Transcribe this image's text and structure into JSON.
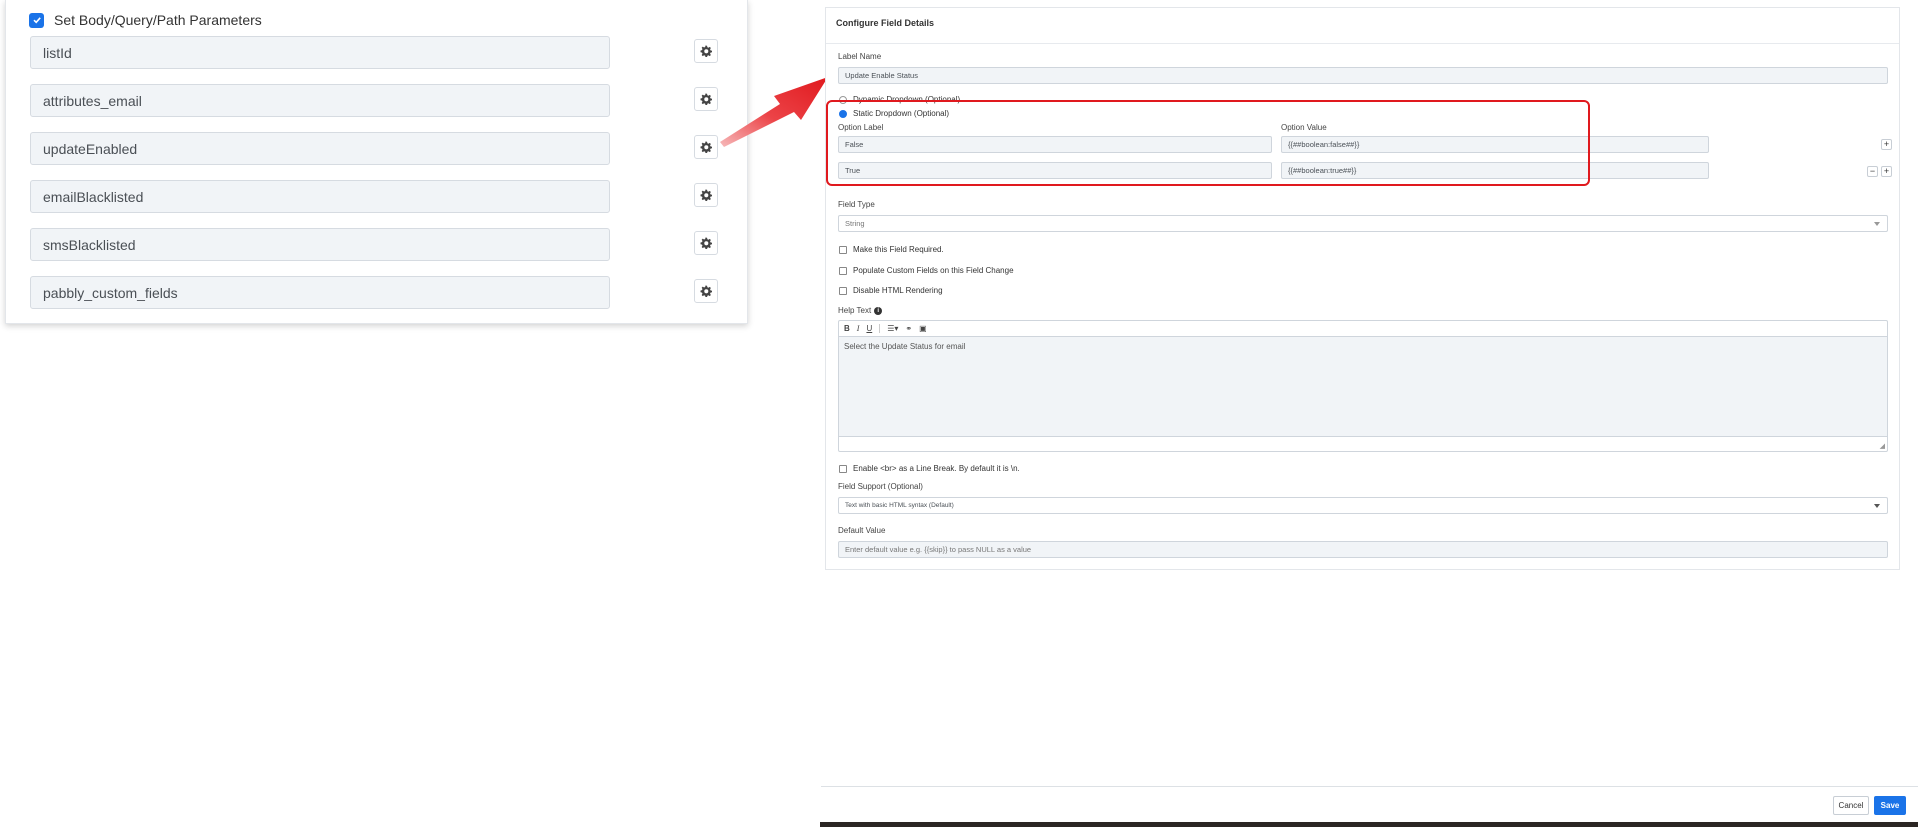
{
  "params": {
    "title": "Set Body/Query/Path Parameters",
    "items": [
      {
        "label": "listId"
      },
      {
        "label": "attributes_email"
      },
      {
        "label": "updateEnabled"
      },
      {
        "label": "emailBlacklisted"
      },
      {
        "label": "smsBlacklisted"
      },
      {
        "label": "pabbly_custom_fields"
      }
    ]
  },
  "config": {
    "title": "Configure Field Details",
    "label_name_label": "Label Name",
    "label_name_value": "Update Enable Status",
    "dynamic_dropdown_label": "Dynamic Dropdown (Optional)",
    "static_dropdown_label": "Static Dropdown (Optional)",
    "option_label_header": "Option Label",
    "option_value_header": "Option Value",
    "options": [
      {
        "label": "False",
        "value": "{{##boolean:false##}}"
      },
      {
        "label": "True",
        "value": "{{##boolean:true##}}"
      }
    ],
    "field_type_label": "Field Type",
    "field_type_value": "String",
    "required_label": "Make this Field Required.",
    "populate_label": "Populate Custom Fields on this Field Change",
    "disable_html_label": "Disable HTML Rendering",
    "help_text_label": "Help Text",
    "help_text_value": "Select the Update Status for email",
    "enable_br_label": "Enable <br> as a Line Break. By default it is \\n.",
    "field_support_label": "Field Support (Optional)",
    "field_support_value": "Text with basic HTML syntax (Default)",
    "default_value_label": "Default Value",
    "default_value_placeholder": "Enter default value e.g. {{skip}} to pass NULL as a value"
  },
  "footer": {
    "cancel_label": "Cancel",
    "save_label": "Save"
  },
  "colors": {
    "accent": "#1a73e8",
    "highlight": "#e0191e"
  }
}
